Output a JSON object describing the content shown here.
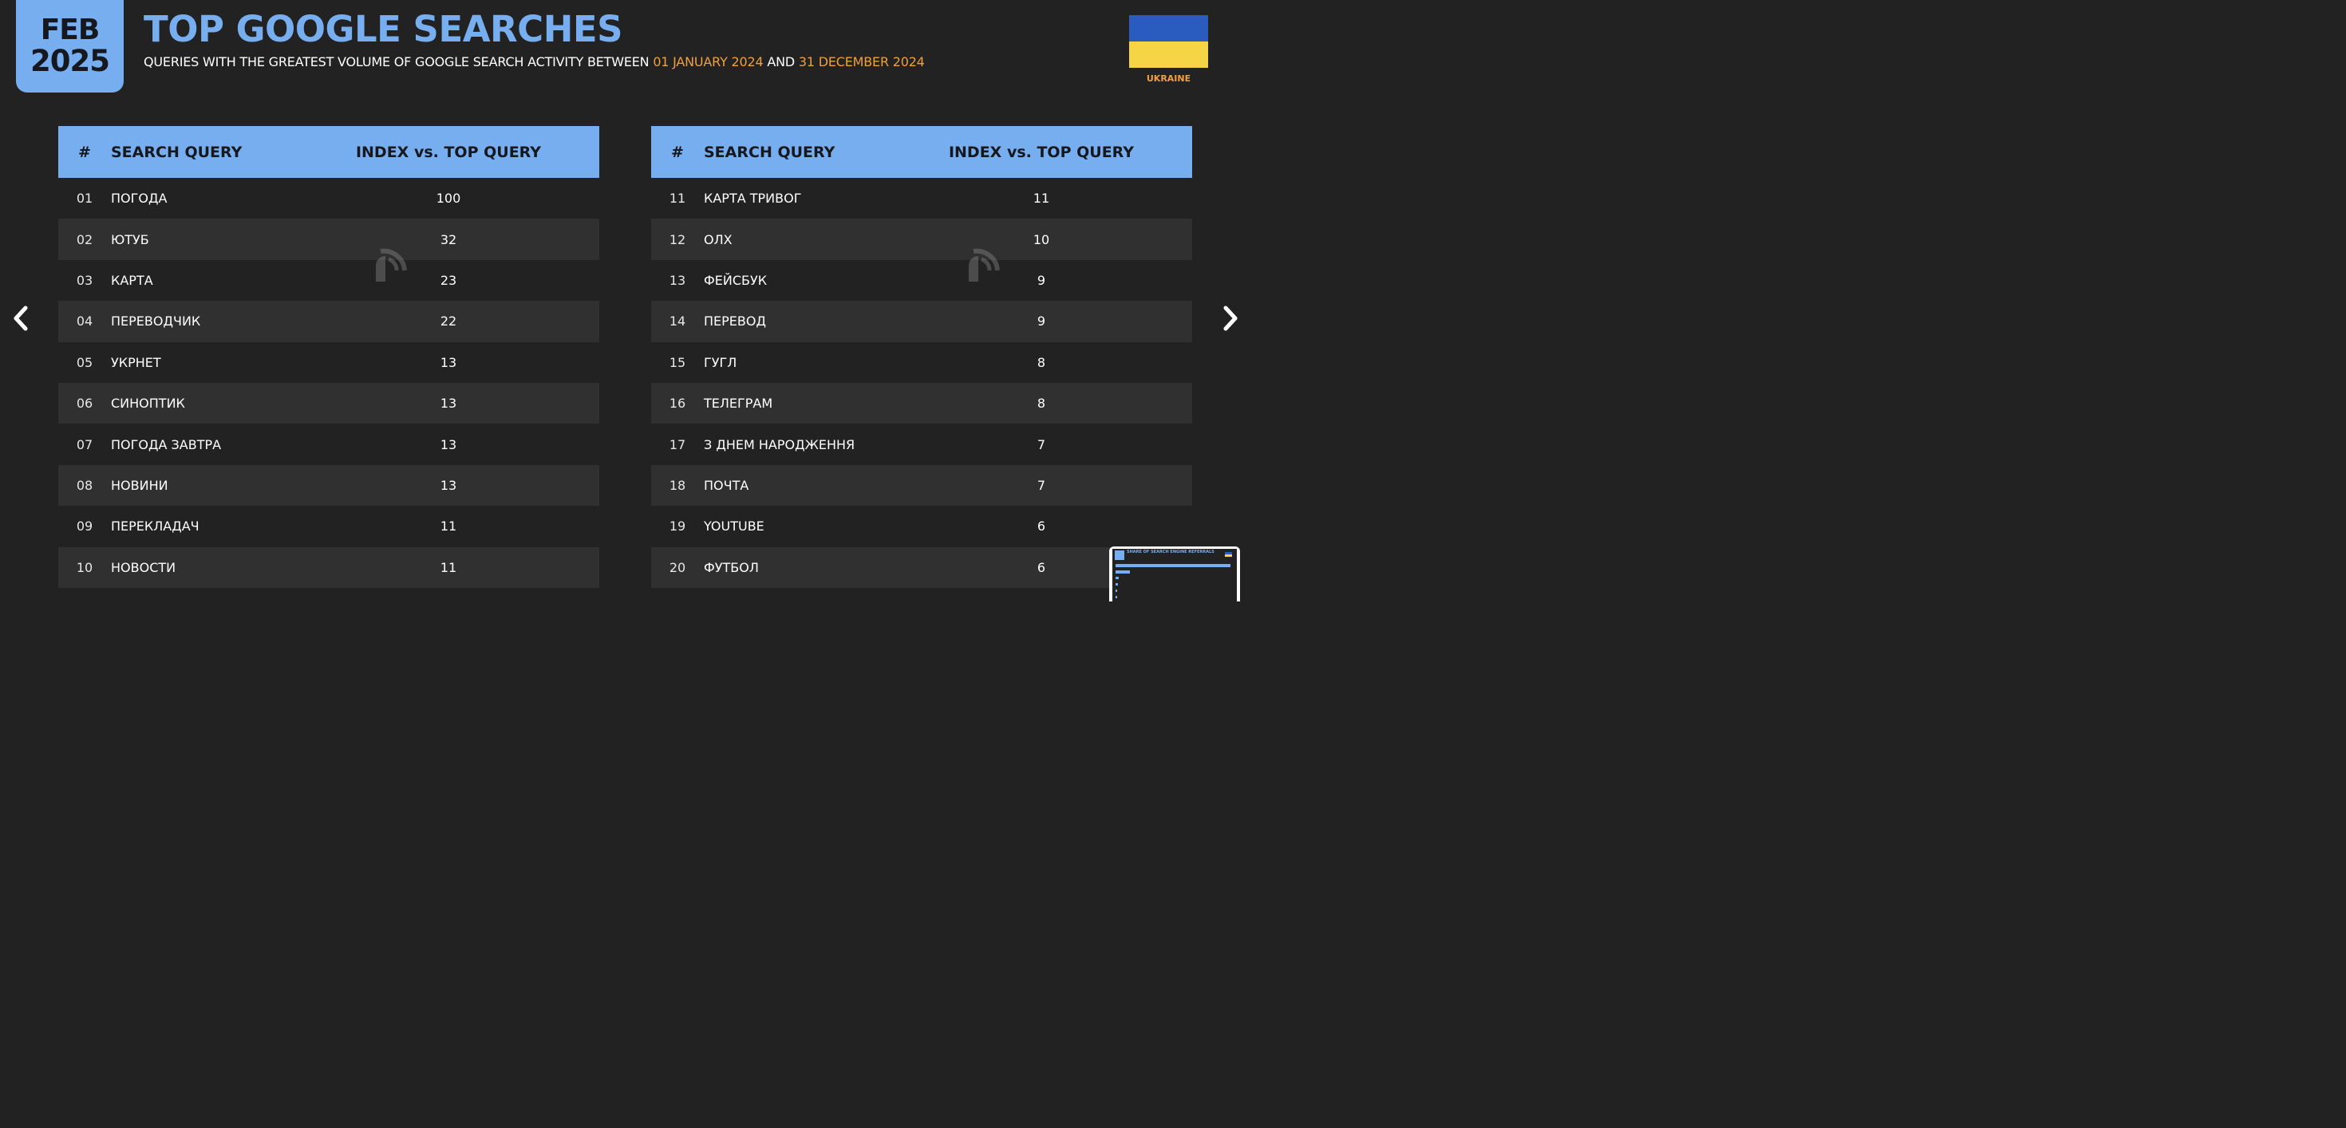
{
  "badge": {
    "month": "FEB",
    "year": "2025"
  },
  "header": {
    "title": "TOP GOOGLE SEARCHES",
    "subtitle_prefix": "QUERIES WITH THE GREATEST VOLUME OF GOOGLE SEARCH ACTIVITY BETWEEN ",
    "date_start": "01 JANUARY 2024",
    "subtitle_mid": " AND ",
    "date_end": "31 DECEMBER 2024",
    "country": "UKRAINE"
  },
  "flag_colors": {
    "top": "#2a5bbf",
    "bottom": "#f5d545"
  },
  "accent": "#76aef0",
  "highlight": "#f0a040",
  "columns": {
    "rank": "#",
    "query": "SEARCH QUERY",
    "index": "INDEX vs. TOP QUERY"
  },
  "left_table": [
    {
      "rank": "01",
      "query": "ПОГОДА",
      "index": "100"
    },
    {
      "rank": "02",
      "query": "ЮТУБ",
      "index": "32"
    },
    {
      "rank": "03",
      "query": "КАРТА",
      "index": "23"
    },
    {
      "rank": "04",
      "query": "ПЕРЕВОДЧИК",
      "index": "22"
    },
    {
      "rank": "05",
      "query": "УКРНЕТ",
      "index": "13"
    },
    {
      "rank": "06",
      "query": "СИНОПТИК",
      "index": "13"
    },
    {
      "rank": "07",
      "query": "ПОГОДА ЗАВТРА",
      "index": "13"
    },
    {
      "rank": "08",
      "query": "НОВИНИ",
      "index": "13"
    },
    {
      "rank": "09",
      "query": "ПЕРЕКЛАДАЧ",
      "index": "11"
    },
    {
      "rank": "10",
      "query": "НОВОСТИ",
      "index": "11"
    }
  ],
  "right_table": [
    {
      "rank": "11",
      "query": "КАРТА ТРИВОГ",
      "index": "11"
    },
    {
      "rank": "12",
      "query": "ОЛХ",
      "index": "10"
    },
    {
      "rank": "13",
      "query": "ФЕЙСБУК",
      "index": "9"
    },
    {
      "rank": "14",
      "query": "ПЕРЕВОД",
      "index": "9"
    },
    {
      "rank": "15",
      "query": "ГУГЛ",
      "index": "8"
    },
    {
      "rank": "16",
      "query": "ТЕЛЕГРАМ",
      "index": "8"
    },
    {
      "rank": "17",
      "query": "З ДНЕМ НАРОДЖЕННЯ",
      "index": "7"
    },
    {
      "rank": "18",
      "query": "ПОЧТА",
      "index": "7"
    },
    {
      "rank": "19",
      "query": "YOUTUBE",
      "index": "6"
    },
    {
      "rank": "20",
      "query": "ФУТБОЛ",
      "index": "6"
    }
  ],
  "icons": {
    "prev": "chevron-left-icon",
    "next": "chevron-right-icon",
    "watermark": "datareportal-logo-icon"
  },
  "thumbnail": {
    "title": "SHARE OF SEARCH ENGINE REFERRALS"
  }
}
